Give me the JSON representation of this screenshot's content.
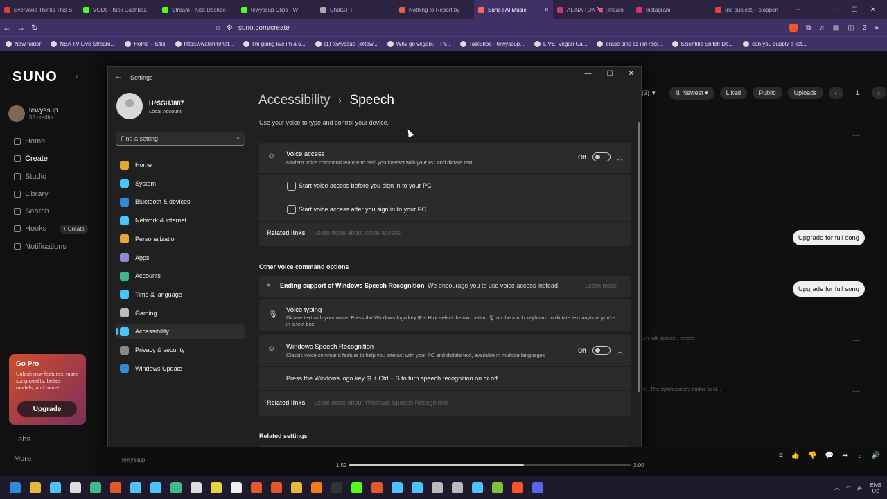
{
  "browser": {
    "tabs": [
      {
        "label": "Everyone Thinks This S",
        "color": "#e03a3a"
      },
      {
        "label": "VODs - Kick Dashboa",
        "color": "#53fc18"
      },
      {
        "label": "Stream - Kick Dashbo",
        "color": "#53fc18"
      },
      {
        "label": "tewyssup Clips - W",
        "color": "#53fc18"
      },
      {
        "label": "ChatGPT",
        "color": "#aaaaaa"
      },
      {
        "label": "Nothing to Report by",
        "color": "#e0643a"
      },
      {
        "label": "Suno | AI Music",
        "color": "#ff6a4d",
        "active": true
      },
      {
        "label": "ALINA TOK 💘 (@aato",
        "color": "#d6336c"
      },
      {
        "label": "Instagram",
        "color": "#d6336c"
      },
      {
        "label": "(no subject) - sloppen",
        "color": "#ea4335"
      }
    ],
    "url": "suno.com/create",
    "tab_count": "2",
    "bookmarks": [
      "New folder",
      "NBA TV Live Stream...",
      "Home – Sflix",
      "https://watchmmaf...",
      "I'm going live im a s...",
      "(1) tewyssup (@tew...",
      "Why go vegan? | Th...",
      "TalkShoe - tewyssup...",
      "LIVE: Vegan Ca...",
      "erase sins as i'm raci...",
      "Scientific Snitch De...",
      "can you supply a list..."
    ]
  },
  "suno": {
    "logo": "SUNO",
    "user": {
      "name": "tewyssup",
      "credits": "55 credits"
    },
    "nav": [
      "Home",
      "Create",
      "Studio",
      "Library",
      "Search",
      "Hooks",
      "Notifications"
    ],
    "hooks_create": "+ Create",
    "gopro": {
      "title": "Go Pro",
      "text": "Unlock new features, more song credits, better models, and more!",
      "button": "Upgrade"
    },
    "labs": "Labs",
    "more": "More",
    "filters": {
      "count": "(3)",
      "sort": "Newest",
      "liked": "Liked",
      "public": "Public",
      "uploads": "Uploads",
      "page": "1"
    },
    "upgrade_full": "Upgrade for full song",
    "snippet1": "um talk spoken, reverb",
    "snippet2": "ne. The synthesizer's timbre is cl...",
    "player": {
      "artist": "tewyssup",
      "elapsed": "1:52",
      "total": "3:00",
      "progress": 0.62
    }
  },
  "settings": {
    "title": "Settings",
    "user": {
      "name": "H^$GHJ887",
      "type": "Local Account"
    },
    "search_placeholder": "Find a setting",
    "nav": [
      {
        "label": "Home",
        "color": "#e8a33d"
      },
      {
        "label": "System",
        "color": "#4cc2ff"
      },
      {
        "label": "Bluetooth & devices",
        "color": "#2f8bd8"
      },
      {
        "label": "Network & internet",
        "color": "#4cc2ff"
      },
      {
        "label": "Personalization",
        "color": "#e8a33d"
      },
      {
        "label": "Apps",
        "color": "#8a8ad8"
      },
      {
        "label": "Accounts",
        "color": "#3fb98a"
      },
      {
        "label": "Time & language",
        "color": "#4cc2ff"
      },
      {
        "label": "Gaming",
        "color": "#bbbbbb"
      },
      {
        "label": "Accessibility",
        "color": "#4cc2ff",
        "active": true
      },
      {
        "label": "Privacy & security",
        "color": "#888888"
      },
      {
        "label": "Windows Update",
        "color": "#2f8bd8"
      }
    ],
    "breadcrumb": {
      "parent": "Accessibility",
      "current": "Speech"
    },
    "description": "Use your voice to type and control your device.",
    "voice_access": {
      "title": "Voice access",
      "subtitle": "Modern voice command feature to help you interact with your PC and dictate text",
      "state": "Off",
      "option1": "Start voice access before you sign in to your PC",
      "option2": "Start voice access after you sign in to your PC",
      "related_label": "Related links",
      "related_link": "Learn more about voice access"
    },
    "other_header": "Other voice command options",
    "ending": {
      "title": "Ending support of Windows Speech Recognition",
      "text": "We encourage you to use voice access instead.",
      "link": "Learn more"
    },
    "voice_typing": {
      "title": "Voice typing",
      "subtitle": "Dictate text with your voice. Press the Windows logo key ⊞ + H or select the mic button 🎙 on the touch keyboard to dictate text anytime you're in a text box."
    },
    "wsr": {
      "title": "Windows Speech Recognition",
      "subtitle": "Classic voice command feature to help you interact with your PC and dictate text, available in multiple languages",
      "state": "Off",
      "hint": "Press the Windows logo key ⊞ + Ctrl + S to turn speech recognition on or off",
      "related_label": "Related links",
      "related_link": "Learn more about Windows Speech Recognition"
    },
    "related_settings": "Related settings"
  },
  "taskbar": {
    "icons": [
      "#2f8bd8",
      "#e8b83d",
      "#4cc2ff",
      "#dddddd",
      "#3fb98a",
      "#e05a2b",
      "#4cc2ff",
      "#4cc2ff",
      "#3fb98a",
      "#dddddd",
      "#e8d23d",
      "#eeeeee",
      "#e05a2b",
      "#e05a2b",
      "#e8b83d",
      "#f07d1a",
      "#333333",
      "#53fc18",
      "#e05a2b",
      "#4cc2ff",
      "#4cc2ff",
      "#bbbbbb",
      "#bbbbbb",
      "#4cc2ff",
      "#7cc23d",
      "#fb542b",
      "#5865f2"
    ],
    "lang_top": "ENG",
    "lang_bottom": "US"
  }
}
